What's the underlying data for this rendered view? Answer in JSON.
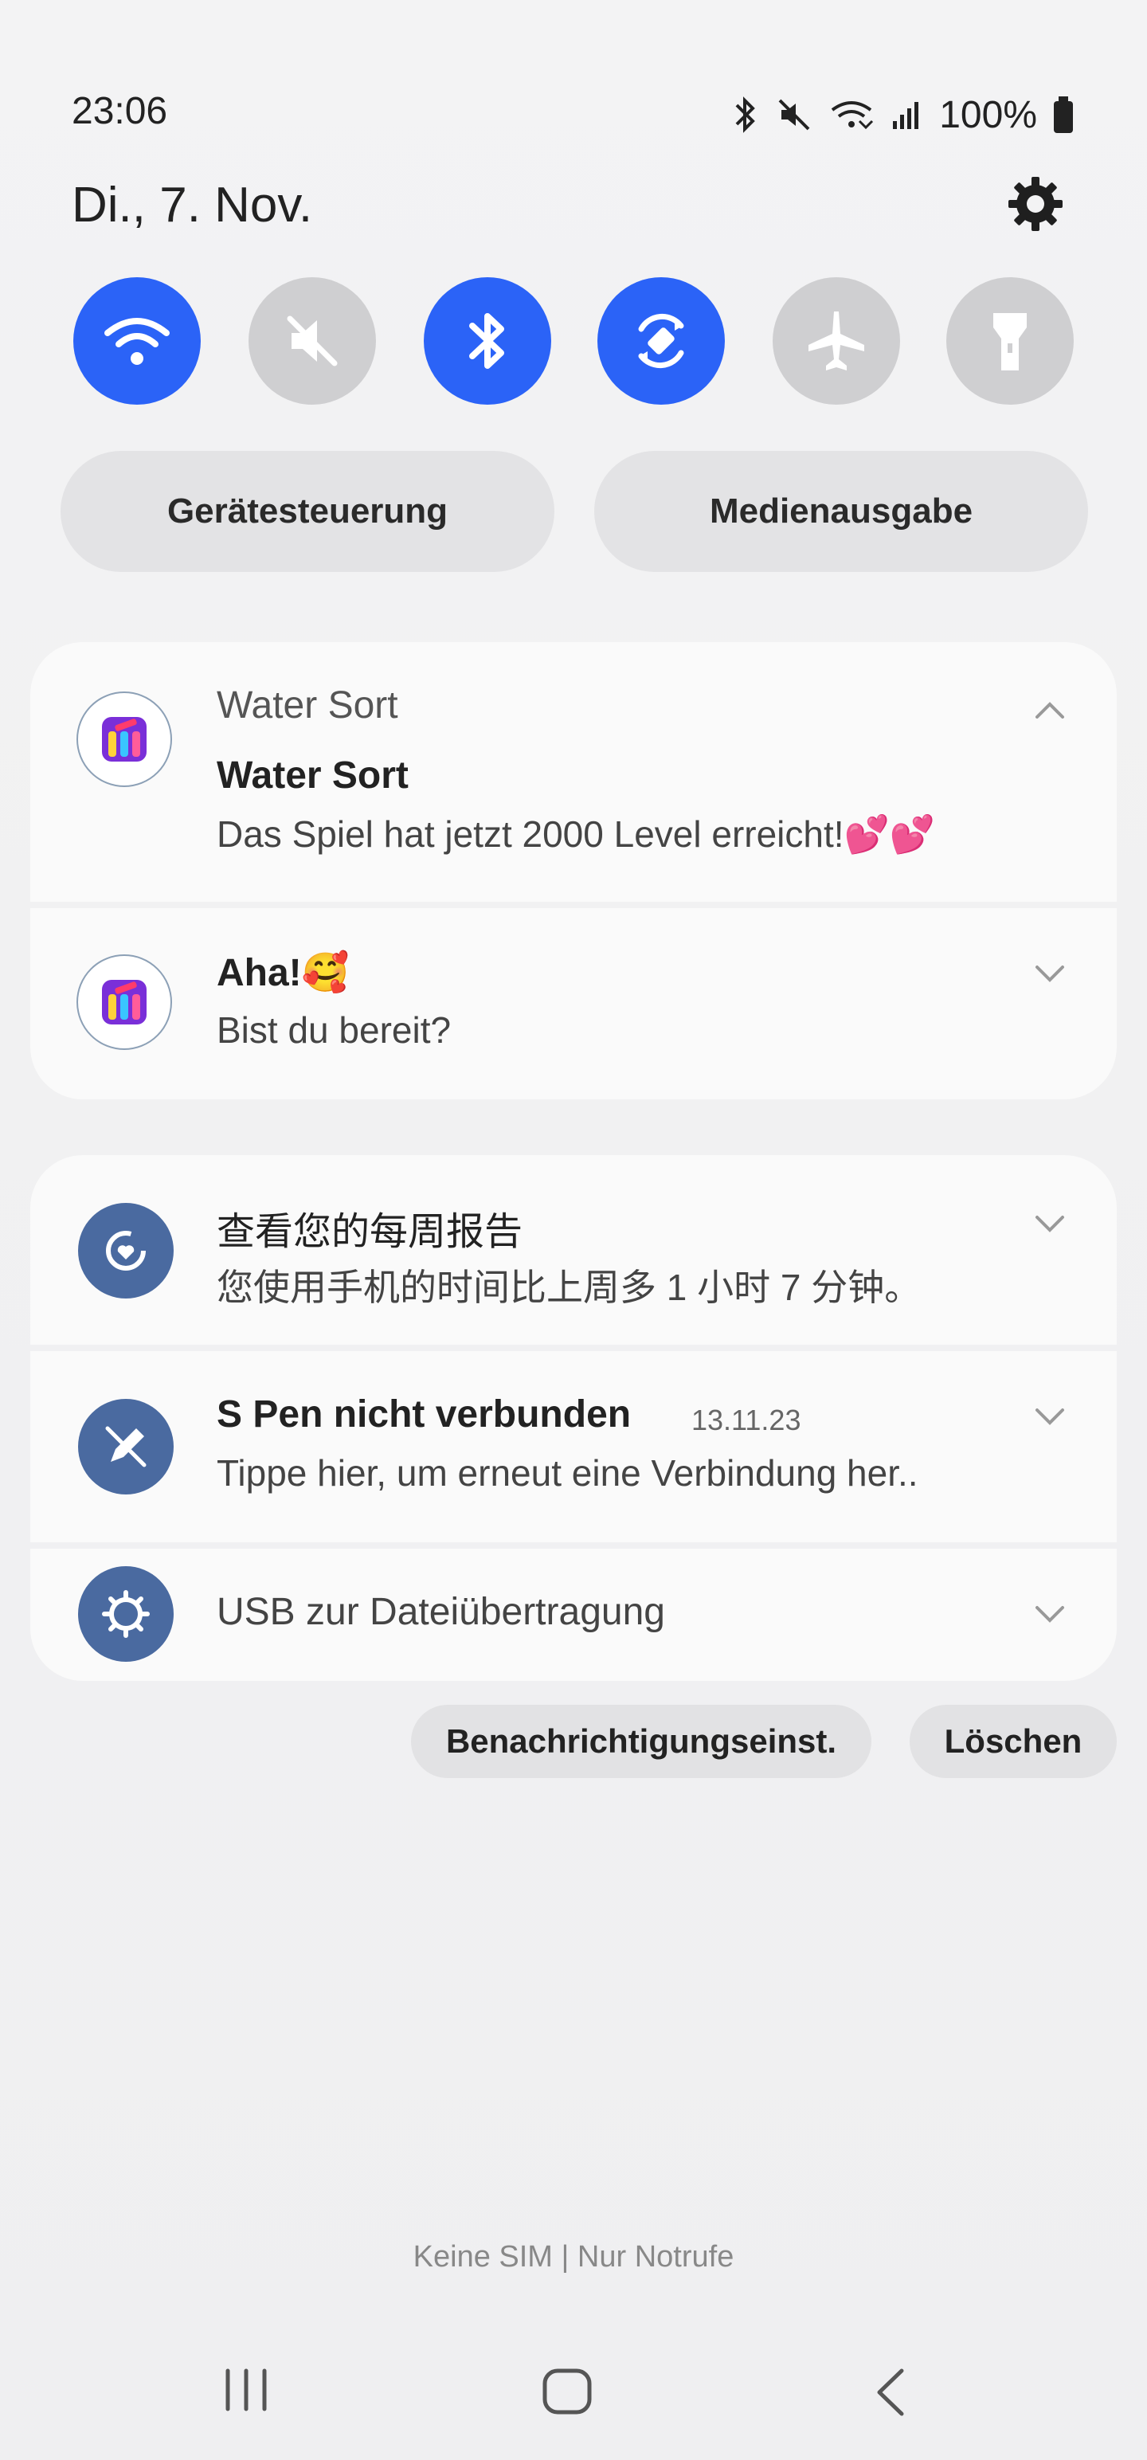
{
  "status_bar": {
    "time": "23:06",
    "battery_percent": "100%"
  },
  "header": {
    "date": "Di., 7. Nov."
  },
  "quick_toggles": [
    {
      "name": "wifi",
      "active": true
    },
    {
      "name": "sound-mute",
      "active": false
    },
    {
      "name": "bluetooth",
      "active": true
    },
    {
      "name": "auto-rotate",
      "active": true
    },
    {
      "name": "airplane-mode",
      "active": false
    },
    {
      "name": "flashlight",
      "active": false
    }
  ],
  "quick_buttons": {
    "device_control": "Gerätesteuerung",
    "media_output": "Medienausgabe"
  },
  "notifications": {
    "water_sort_group": {
      "app_name": "Water Sort",
      "title": "Water Sort",
      "text": "Das Spiel hat jetzt 2000 Level erreicht!💕💕"
    },
    "water_sort_second": {
      "title": "Aha!🥰",
      "text": "Bist du bereit?"
    },
    "weekly_report": {
      "title": "查看您的每周报告",
      "text": "您使用手机的时间比上周多 1 小时 7 分钟。"
    },
    "spen": {
      "title": "S Pen nicht verbunden",
      "time": "13.11.23",
      "text": "Tippe hier, um erneut eine Verbindung her.."
    },
    "usb": {
      "title": "USB zur Dateiübertragung"
    }
  },
  "actions": {
    "notification_settings": "Benachrichtigungseinst.",
    "clear": "Löschen"
  },
  "footer": {
    "carrier": "Keine SIM | Nur Notrufe"
  },
  "colors": {
    "accent": "#2b63f7",
    "toggle_off": "#cfcfd1",
    "system_icon_bg": "#4a6aa0"
  }
}
